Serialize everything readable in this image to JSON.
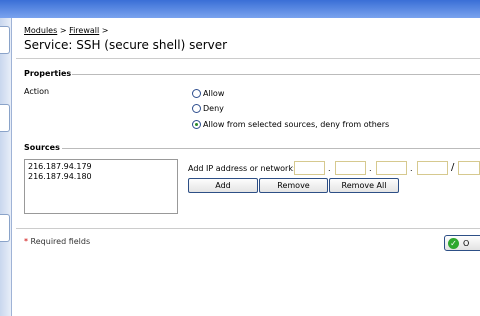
{
  "breadcrumb": {
    "item1": "Modules",
    "sep": ">",
    "item2": "Firewall",
    "trail": ">"
  },
  "page_title": "Service: SSH (secure shell) server",
  "properties": {
    "heading": "Properties",
    "action_label": "Action",
    "options": [
      "Allow",
      "Deny",
      "Allow from selected sources, deny from others"
    ],
    "selected_index": 2
  },
  "sources": {
    "heading": "Sources",
    "list": [
      "216.187.94.179",
      "216.187.94.180"
    ],
    "ip_label": "Add IP address or network:",
    "octet_sep": ".",
    "mask_sep": "/",
    "add_label": "Add",
    "remove_label": "Remove",
    "remove_all_label": "Remove All"
  },
  "footer": {
    "required_star": "*",
    "required_text": "Required fields",
    "ok_label": "O"
  },
  "colors": {
    "accent": "#2d4f86",
    "required": "#cc0000",
    "ok_green": "#2fa82f"
  }
}
